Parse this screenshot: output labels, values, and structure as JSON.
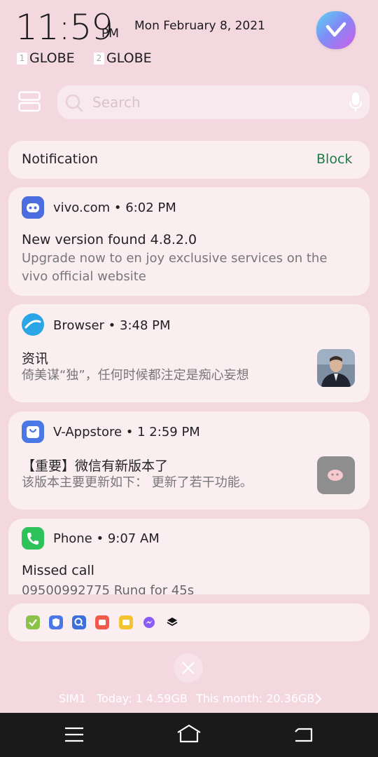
{
  "status": {
    "time": "11:59",
    "ampm": "PM",
    "date": "Mon February 8, 2021",
    "sim1_num": "1",
    "sim1_carrier": "GLOBE",
    "sim2_num": "2",
    "sim2_carrier": "GLOBE"
  },
  "search": {
    "placeholder": "Search"
  },
  "notification_header": {
    "title": "Notification",
    "block_label": "Block"
  },
  "notifications": [
    {
      "app": "vivo.com",
      "time": "6:02 PM",
      "title": "New version found 4.8.2.0",
      "body": "Upgrade now to en joy exclusive services on the vivo official website",
      "icon": "vivo-robot-icon",
      "color": "#4a6ee0"
    },
    {
      "app": "Browser",
      "time": "3:48 PM",
      "title": "资讯",
      "body": "倚美谋“独”，任何时候都注定是痴心妄想",
      "icon": "browser-icon",
      "color": "#2aa6e6"
    },
    {
      "app": "V-Appstore",
      "time": "1 2:59 PM",
      "title": "【重要】微信有新版本了",
      "body": "该版本主要更新如下： 更新了若干功能。",
      "icon": "appstore-bag-icon",
      "color": "#4a79e6"
    },
    {
      "app": "Phone",
      "time": "9:07 AM",
      "title": "Missed call",
      "body": "09500992775 Rung for 45s",
      "icon": "phone-icon",
      "color": "#2dc35a"
    }
  ],
  "dock_icons": [
    "notes-icon",
    "shield-icon",
    "search-app-icon",
    "screen-record-icon",
    "message-icon",
    "messenger-icon",
    "layers-icon"
  ],
  "data_usage": {
    "sim": "SIM1",
    "today": "Today: 1 4.59GB",
    "month": "This month: 20.36GB"
  }
}
